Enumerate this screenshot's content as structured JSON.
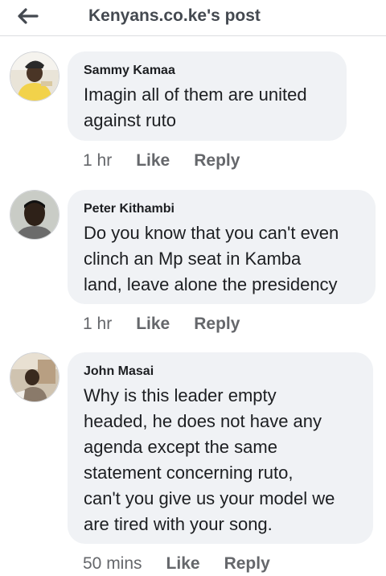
{
  "header": {
    "title": "Kenyans.co.ke's post"
  },
  "comments": [
    {
      "author": "Sammy Kamaa",
      "lines": [
        "Imagin all of them are united",
        "against ruto"
      ],
      "time": "1 hr",
      "like": "Like",
      "reply": "Reply"
    },
    {
      "author": "Peter Kithambi",
      "lines": [
        "Do you know that you can't even",
        "clinch an Mp seat in Kamba",
        "land, leave alone the presidency"
      ],
      "time": "1 hr",
      "like": "Like",
      "reply": "Reply"
    },
    {
      "author": "John Masai",
      "lines": [
        "Why is this leader empty",
        "headed, he does not have any",
        "agenda except the same",
        "statement concerning ruto,",
        "can't you give us your model we",
        "are tired with your song."
      ],
      "time": "50 mins",
      "like": "Like",
      "reply": "Reply"
    }
  ],
  "colors": {
    "bubble": "#f0f2f5",
    "meta": "#65676b",
    "text": "#1c1e21"
  }
}
